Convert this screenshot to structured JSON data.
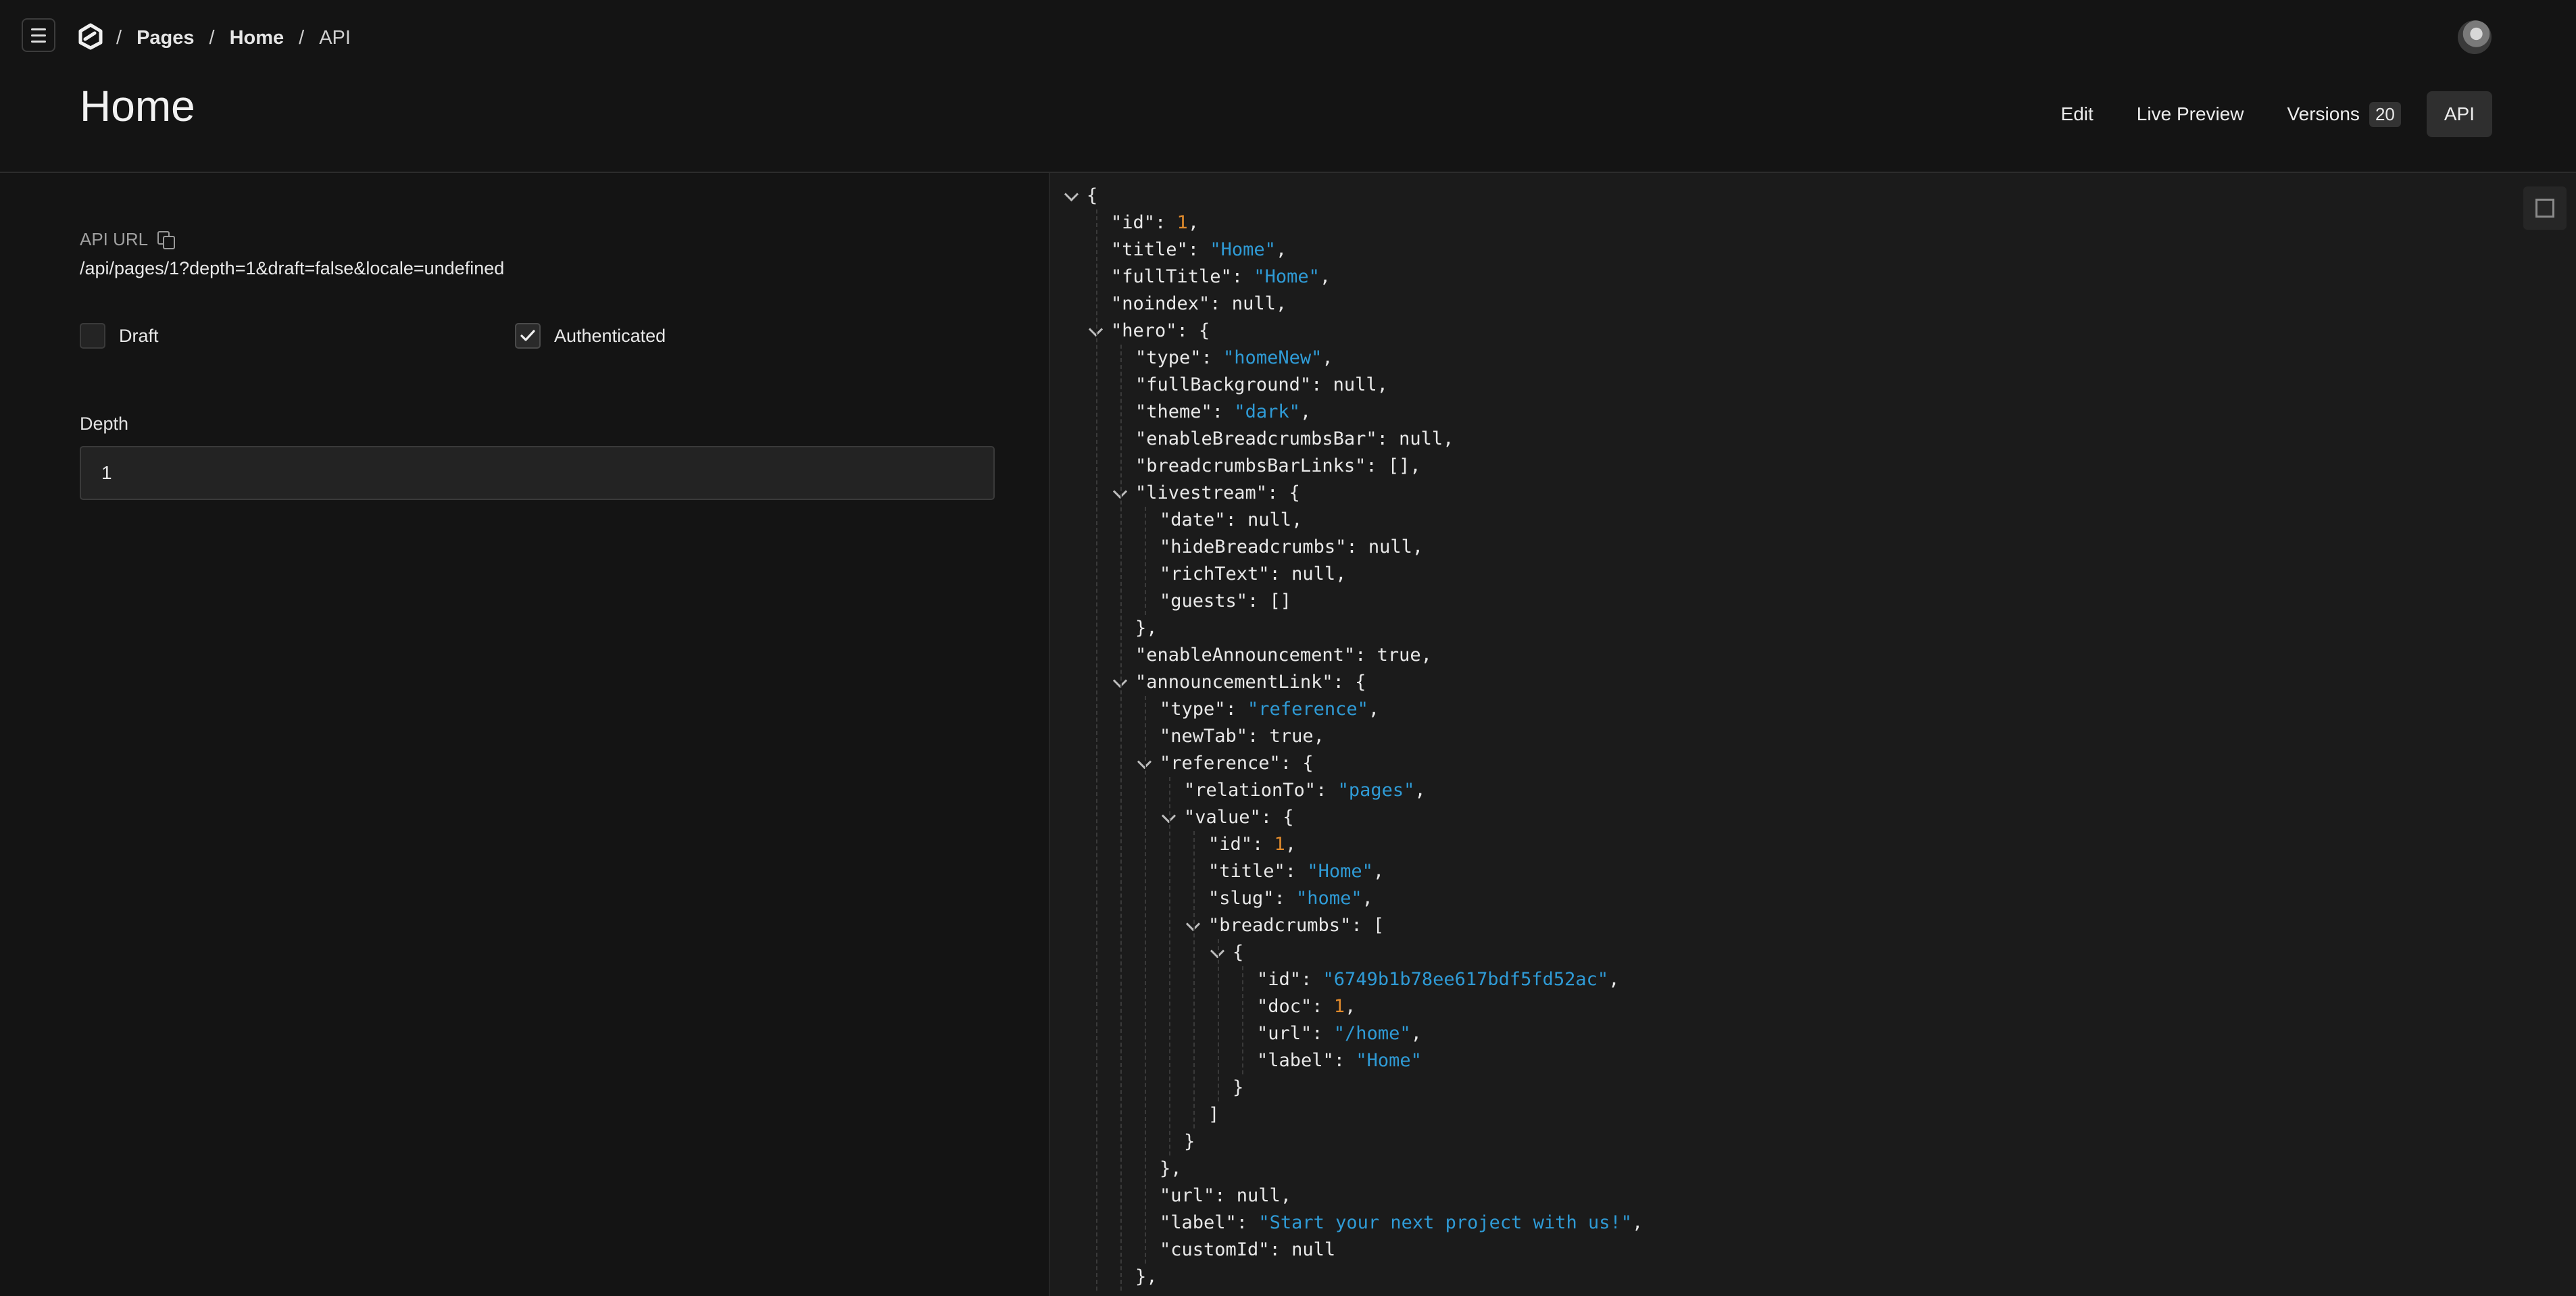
{
  "nav": {
    "breadcrumbs": [
      "Pages",
      "Home",
      "API"
    ],
    "separator": "/"
  },
  "header": {
    "title": "Home",
    "tabs": [
      {
        "label": "Edit"
      },
      {
        "label": "Live Preview"
      },
      {
        "label": "Versions",
        "count": "20"
      },
      {
        "label": "API",
        "active": true
      }
    ]
  },
  "form": {
    "api_url_label": "API URL",
    "api_url": "/api/pages/1?depth=1&draft=false&locale=undefined",
    "draft_label": "Draft",
    "draft_checked": false,
    "authenticated_label": "Authenticated",
    "authenticated_checked": true,
    "depth_label": "Depth",
    "depth_value": "1"
  },
  "json_lines": [
    {
      "depth": 0,
      "fold": true,
      "parts": [
        [
          "p",
          "{"
        ]
      ]
    },
    {
      "depth": 1,
      "parts": [
        [
          "p",
          "\"id\": "
        ],
        [
          "n",
          "1"
        ],
        [
          "p",
          ","
        ]
      ]
    },
    {
      "depth": 1,
      "parts": [
        [
          "p",
          "\"title\": "
        ],
        [
          "s",
          "\"Home\""
        ],
        [
          "p",
          ","
        ]
      ]
    },
    {
      "depth": 1,
      "parts": [
        [
          "p",
          "\"fullTitle\": "
        ],
        [
          "s",
          "\"Home\""
        ],
        [
          "p",
          ","
        ]
      ]
    },
    {
      "depth": 1,
      "parts": [
        [
          "p",
          "\"noindex\": null,"
        ]
      ]
    },
    {
      "depth": 1,
      "fold": true,
      "parts": [
        [
          "p",
          "\"hero\": {"
        ]
      ]
    },
    {
      "depth": 2,
      "parts": [
        [
          "p",
          "\"type\": "
        ],
        [
          "s",
          "\"homeNew\""
        ],
        [
          "p",
          ","
        ]
      ]
    },
    {
      "depth": 2,
      "parts": [
        [
          "p",
          "\"fullBackground\": null,"
        ]
      ]
    },
    {
      "depth": 2,
      "parts": [
        [
          "p",
          "\"theme\": "
        ],
        [
          "s",
          "\"dark\""
        ],
        [
          "p",
          ","
        ]
      ]
    },
    {
      "depth": 2,
      "parts": [
        [
          "p",
          "\"enableBreadcrumbsBar\": null,"
        ]
      ]
    },
    {
      "depth": 2,
      "parts": [
        [
          "p",
          "\"breadcrumbsBarLinks\": [],"
        ]
      ]
    },
    {
      "depth": 2,
      "fold": true,
      "parts": [
        [
          "p",
          "\"livestream\": {"
        ]
      ]
    },
    {
      "depth": 3,
      "parts": [
        [
          "p",
          "\"date\": null,"
        ]
      ]
    },
    {
      "depth": 3,
      "parts": [
        [
          "p",
          "\"hideBreadcrumbs\": null,"
        ]
      ]
    },
    {
      "depth": 3,
      "parts": [
        [
          "p",
          "\"richText\": null,"
        ]
      ]
    },
    {
      "depth": 3,
      "parts": [
        [
          "p",
          "\"guests\": []"
        ]
      ]
    },
    {
      "depth": 2,
      "close": true,
      "parts": [
        [
          "p",
          "},"
        ]
      ]
    },
    {
      "depth": 2,
      "parts": [
        [
          "p",
          "\"enableAnnouncement\": true,"
        ]
      ]
    },
    {
      "depth": 2,
      "fold": true,
      "parts": [
        [
          "p",
          "\"announcementLink\": {"
        ]
      ]
    },
    {
      "depth": 3,
      "parts": [
        [
          "p",
          "\"type\": "
        ],
        [
          "s",
          "\"reference\""
        ],
        [
          "p",
          ","
        ]
      ]
    },
    {
      "depth": 3,
      "parts": [
        [
          "p",
          "\"newTab\": true,"
        ]
      ]
    },
    {
      "depth": 3,
      "fold": true,
      "parts": [
        [
          "p",
          "\"reference\": {"
        ]
      ]
    },
    {
      "depth": 4,
      "parts": [
        [
          "p",
          "\"relationTo\": "
        ],
        [
          "s",
          "\"pages\""
        ],
        [
          "p",
          ","
        ]
      ]
    },
    {
      "depth": 4,
      "fold": true,
      "parts": [
        [
          "p",
          "\"value\": {"
        ]
      ]
    },
    {
      "depth": 5,
      "parts": [
        [
          "p",
          "\"id\": "
        ],
        [
          "n",
          "1"
        ],
        [
          "p",
          ","
        ]
      ]
    },
    {
      "depth": 5,
      "parts": [
        [
          "p",
          "\"title\": "
        ],
        [
          "s",
          "\"Home\""
        ],
        [
          "p",
          ","
        ]
      ]
    },
    {
      "depth": 5,
      "parts": [
        [
          "p",
          "\"slug\": "
        ],
        [
          "s",
          "\"home\""
        ],
        [
          "p",
          ","
        ]
      ]
    },
    {
      "depth": 5,
      "fold": true,
      "parts": [
        [
          "p",
          "\"breadcrumbs\": ["
        ]
      ]
    },
    {
      "depth": 6,
      "fold": true,
      "parts": [
        [
          "p",
          "{"
        ]
      ]
    },
    {
      "depth": 7,
      "parts": [
        [
          "p",
          "\"id\": "
        ],
        [
          "s",
          "\"6749b1b78ee617bdf5fd52ac\""
        ],
        [
          "p",
          ","
        ]
      ]
    },
    {
      "depth": 7,
      "parts": [
        [
          "p",
          "\"doc\": "
        ],
        [
          "n",
          "1"
        ],
        [
          "p",
          ","
        ]
      ]
    },
    {
      "depth": 7,
      "parts": [
        [
          "p",
          "\"url\": "
        ],
        [
          "s",
          "\"/home\""
        ],
        [
          "p",
          ","
        ]
      ]
    },
    {
      "depth": 7,
      "parts": [
        [
          "p",
          "\"label\": "
        ],
        [
          "s",
          "\"Home\""
        ]
      ]
    },
    {
      "depth": 6,
      "close": true,
      "parts": [
        [
          "p",
          "}"
        ]
      ]
    },
    {
      "depth": 5,
      "close": true,
      "parts": [
        [
          "p",
          "]"
        ]
      ]
    },
    {
      "depth": 4,
      "close": true,
      "parts": [
        [
          "p",
          "}"
        ]
      ]
    },
    {
      "depth": 3,
      "close": true,
      "parts": [
        [
          "p",
          "},"
        ]
      ]
    },
    {
      "depth": 3,
      "parts": [
        [
          "p",
          "\"url\": null,"
        ]
      ]
    },
    {
      "depth": 3,
      "parts": [
        [
          "p",
          "\"label\": "
        ],
        [
          "s",
          "\"Start your next project with us!\""
        ],
        [
          "p",
          ","
        ]
      ]
    },
    {
      "depth": 3,
      "parts": [
        [
          "p",
          "\"customId\": null"
        ]
      ]
    },
    {
      "depth": 2,
      "close": true,
      "parts": [
        [
          "p",
          "},"
        ]
      ]
    }
  ]
}
